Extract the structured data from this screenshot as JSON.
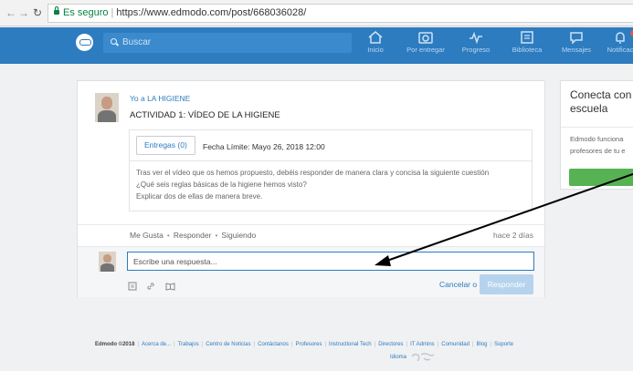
{
  "browser": {
    "secure_label": "Es seguro",
    "url": "https://www.edmodo.com/post/668036028/"
  },
  "header": {
    "search_placeholder": "Buscar",
    "nav": [
      {
        "label": "Inicio",
        "icon": "home-icon"
      },
      {
        "label": "Por entregar",
        "icon": "camera-icon"
      },
      {
        "label": "Progreso",
        "icon": "progress-icon"
      },
      {
        "label": "Biblioteca",
        "icon": "library-icon"
      },
      {
        "label": "Mensajes",
        "icon": "chat-icon"
      },
      {
        "label": "Notificac",
        "icon": "bell-icon"
      }
    ],
    "colors": {
      "bar": "#2d7cc0",
      "notification": "#e8574c"
    }
  },
  "post": {
    "author_line": "Yo a LA HIGIENE",
    "title": "ACTIVIDAD 1: VÍDEO DE LA HIGIENE",
    "entregas_label": "Entregas (0)",
    "due_date": "Fecha Límite: Mayo 26, 2018 12:00",
    "description": [
      "Tras ver el vídeo que os hemos propuesto, debéis responder de manera clara y concisa la siguiente cuestión",
      "¿Qué seis reglas básicas de la higiene hemos visto?",
      "Explicar dos de ellas de manera breve."
    ],
    "actions": {
      "like": "Me Gusta",
      "reply": "Responder",
      "follow": "Siguiendo"
    },
    "time_ago": "hace 2 días",
    "reply_placeholder": "Escribe una respuesta...",
    "cancel_label": "Cancelar o",
    "reply_button": "Responder"
  },
  "right_panel": {
    "title_line1": "Conecta con",
    "title_line2": "escuela",
    "text_line1": "Edmodo funciona",
    "text_line2": "profesores de tu e",
    "button_color": "#56b252"
  },
  "footer": {
    "copyright": "Edmodo ©2018",
    "links": [
      "Acerca de...",
      "Trabajos",
      "Centro de Noticias",
      "Contáctanos",
      "Profesores",
      "Instructional Tech",
      "Directores",
      "IT Admins",
      "Comunidad",
      "Blog",
      "Soporte"
    ],
    "language": "Idioma"
  }
}
